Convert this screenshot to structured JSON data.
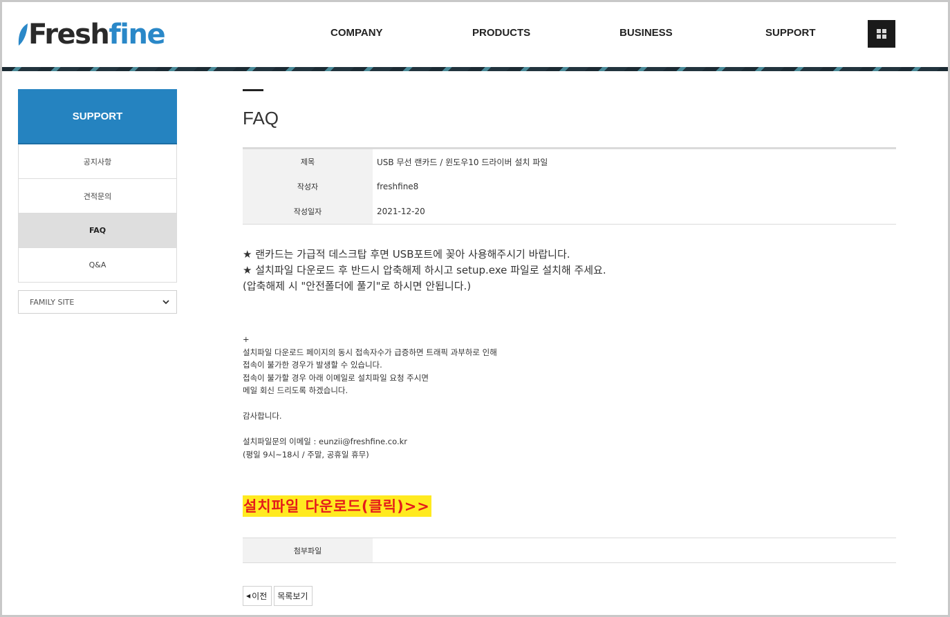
{
  "header": {
    "logo_fresh": "Fresh",
    "logo_fine": "fine",
    "nav": [
      "COMPANY",
      "PRODUCTS",
      "BUSINESS",
      "SUPPORT"
    ]
  },
  "sidebar": {
    "title": "SUPPORT",
    "items": [
      {
        "label": "공지사항",
        "active": false
      },
      {
        "label": "견적문의",
        "active": false
      },
      {
        "label": "FAQ",
        "active": true
      },
      {
        "label": "Q&A",
        "active": false
      }
    ],
    "family_site": "FAMILY SITE"
  },
  "main": {
    "title": "FAQ",
    "info": [
      {
        "label": "제목",
        "value": "USB 무선 랜카드 / 윈도우10 드라이버 설치 파일"
      },
      {
        "label": "작성자",
        "value": "freshfine8"
      },
      {
        "label": "작성일자",
        "value": "2021-12-20"
      }
    ],
    "body_big": [
      "★ 랜카드는 가급적 데스크탑 후면 USB포트에 꽂아 사용해주시기 바랍니다.",
      "★ 설치파일 다운로드 후 반드시 압축해제 하시고 setup.exe 파일로 설치해 주세요.",
      "(압축해제 시 \"안전폴더에 풀기\"로 하시면 안됩니다.)"
    ],
    "body_small": [
      "+",
      "설치파일 다운로드 페이지의 동시 접속자수가 급증하면 트래픽 과부하로 인해",
      "접속이 불가한 경우가 발생할 수 있습니다.",
      "접속이 불가할 경우 아래 이메일로 설치파일 요청 주시면",
      "메일 회신 드리도록 하겠습니다.",
      "",
      "감사합니다.",
      "",
      "설치파일문의 이메일 : eunzii@freshfine.co.kr",
      "(평일 9시~18시 / 주말, 공휴일 휴무)"
    ],
    "download_link": "설치파일 다운로드(클릭)>>",
    "attachment_label": "첨부파일",
    "prev_button": "이전",
    "list_button": "목록보기"
  },
  "colors": {
    "brand_blue": "#2583c0",
    "download_bg": "#ffea20",
    "download_text": "#e41b1b"
  },
  "icons": [
    "leaf-icon",
    "grid-menu-icon",
    "chevron-down-icon",
    "triangle-left-icon"
  ]
}
